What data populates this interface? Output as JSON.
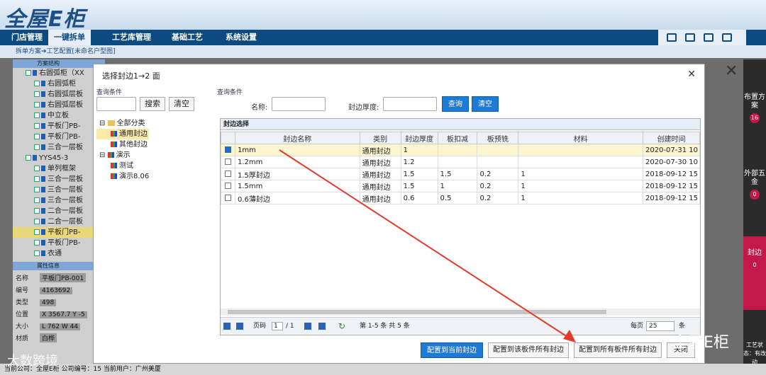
{
  "app": {
    "logo": "全屋E柜"
  },
  "nav": [
    "门店管理",
    "一键拆单",
    "工艺库管理",
    "基础工艺",
    "系统设置"
  ],
  "breadcrumb": "拆单方案➔工艺配置[未命名户型图]",
  "left_panel": {
    "title": "方案结构",
    "tree": [
      {
        "label": "右圆弧柜（XX",
        "level": 1
      },
      {
        "label": "右圆弧柜",
        "level": 2
      },
      {
        "label": "右圆弧层板",
        "level": 2
      },
      {
        "label": "右圆弧层板",
        "level": 2
      },
      {
        "label": "中立板",
        "level": 2
      },
      {
        "label": "平板门PB-",
        "level": 2
      },
      {
        "label": "平板门PB-",
        "level": 2
      },
      {
        "label": "三合一层板",
        "level": 2
      },
      {
        "label": "YYS45-3",
        "level": 1
      },
      {
        "label": "单列框架",
        "level": 2
      },
      {
        "label": "三合一层板",
        "level": 2
      },
      {
        "label": "三合一层板",
        "level": 2
      },
      {
        "label": "三合一层板",
        "level": 2
      },
      {
        "label": "二合一层板",
        "level": 2
      },
      {
        "label": "二合一层板",
        "level": 2
      },
      {
        "label": "平板门PB-",
        "level": 2
      },
      {
        "label": "平板门PB-",
        "level": 2
      },
      {
        "label": "衣通",
        "level": 2
      }
    ]
  },
  "attrs": {
    "title": "属性信息",
    "rows": [
      {
        "k": "名称",
        "v": "平板门PB-001"
      },
      {
        "k": "编号",
        "v": "4163692"
      },
      {
        "k": "类型",
        "v": "498"
      },
      {
        "k": "位置",
        "v": "X 3567.7 Y -5"
      },
      {
        "k": "大小",
        "v": "L 762  W 44"
      },
      {
        "k": "材质",
        "v": "白桦"
      }
    ]
  },
  "footer": "当前公司：全屋E柜   公司编号：15   当前用户：广州美厦",
  "right_sidebar": [
    {
      "label": "布置方案",
      "count": "16"
    },
    {
      "label": "外部五金",
      "count": "0"
    },
    {
      "label": "封边",
      "count": "0"
    }
  ],
  "dialog": {
    "title": "选择封边1→2 面",
    "query_label": "查询条件",
    "search_btn": "搜索",
    "clear_btn": "清空",
    "name_label": "名称:",
    "thickness_label": "封边厚度:",
    "query_btn": "查询",
    "reset_btn": "清空",
    "tree": [
      {
        "label": "全部分类",
        "type": "folder",
        "level": 0
      },
      {
        "label": "通用封边",
        "type": "chart",
        "level": 1
      },
      {
        "label": "其他封边",
        "type": "chart",
        "level": 1
      },
      {
        "label": "演示",
        "type": "chart",
        "level": 0
      },
      {
        "label": "测试",
        "type": "chart",
        "level": 1
      },
      {
        "label": "演示8.06",
        "type": "chart",
        "level": 1
      }
    ],
    "grid_title": "封边选择",
    "columns": [
      "封边名称",
      "类别",
      "封边厚度",
      "板扣减",
      "板预铣",
      "材料",
      "创建时间"
    ],
    "rows": [
      {
        "checked": true,
        "cells": [
          "1mm",
          "通用封边",
          "1",
          "",
          "",
          "",
          "2020-07-31 10"
        ]
      },
      {
        "checked": false,
        "cells": [
          "1.2mm",
          "通用封边",
          "1.2",
          "",
          "",
          "",
          "2020-07-30 10"
        ]
      },
      {
        "checked": false,
        "cells": [
          "1.5厚封边",
          "通用封边",
          "1.5",
          "1.5",
          "0.2",
          "1",
          "2018-09-12 15"
        ]
      },
      {
        "checked": false,
        "cells": [
          "1.5mm",
          "通用封边",
          "1.5",
          "1",
          "0.2",
          "1",
          "2018-09-12 15"
        ]
      },
      {
        "checked": false,
        "cells": [
          "0.6薄封边",
          "通用封边",
          "0.6",
          "0.5",
          "0.2",
          "1",
          "2018-09-12 15"
        ]
      }
    ],
    "pager": {
      "page_label": "页码",
      "page": "1",
      "total_pages": "/ 1",
      "summary": "第 1-5 条  共 5 条",
      "per_page_label": "每页",
      "per_page": "25",
      "unit": "条"
    },
    "buttons": [
      "配置到当前封边",
      "配置到该板件所有封边",
      "配置到所有板件所有封边",
      "关闭"
    ]
  },
  "watermark": [
    "大数跨境",
    "全屋E柜"
  ],
  "status_text": "工艺状态：有改动",
  "annotation_color": "#e53a2b"
}
